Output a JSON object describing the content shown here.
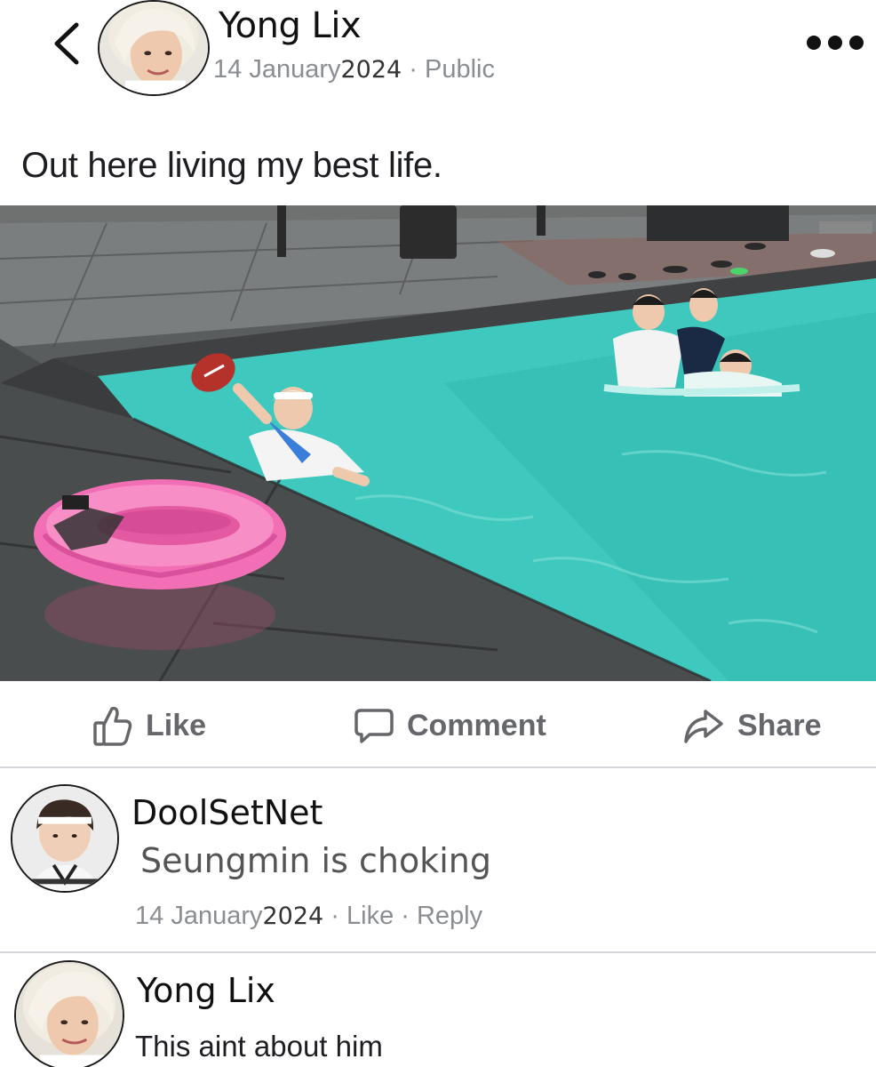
{
  "post": {
    "author": "Yong Lix",
    "date": "14 January",
    "year": "2024",
    "separator": " · ",
    "visibility": "Public",
    "caption": "Out here living my best life."
  },
  "actions": {
    "like": "Like",
    "comment": "Comment",
    "share": "Share"
  },
  "comments": [
    {
      "author": "DoolSetNet",
      "text": "Seungmin is choking",
      "date": "14 January",
      "year": "2024",
      "separator": " · ",
      "like": "Like",
      "reply": "Reply"
    },
    {
      "author": "Yong Lix",
      "text": "This aint about him"
    }
  ],
  "icons": {
    "back": "chevron-left-icon",
    "more": "more-dots-icon",
    "like": "thumbs-up-icon",
    "comment": "speech-bubble-icon",
    "share": "share-arrow-icon"
  },
  "colors": {
    "text_primary": "#1c1e21",
    "text_secondary": "#8a8d91",
    "action_gray": "#65676b",
    "pool_water": "#3cc9c0",
    "float_pink": "#f26fb5"
  }
}
